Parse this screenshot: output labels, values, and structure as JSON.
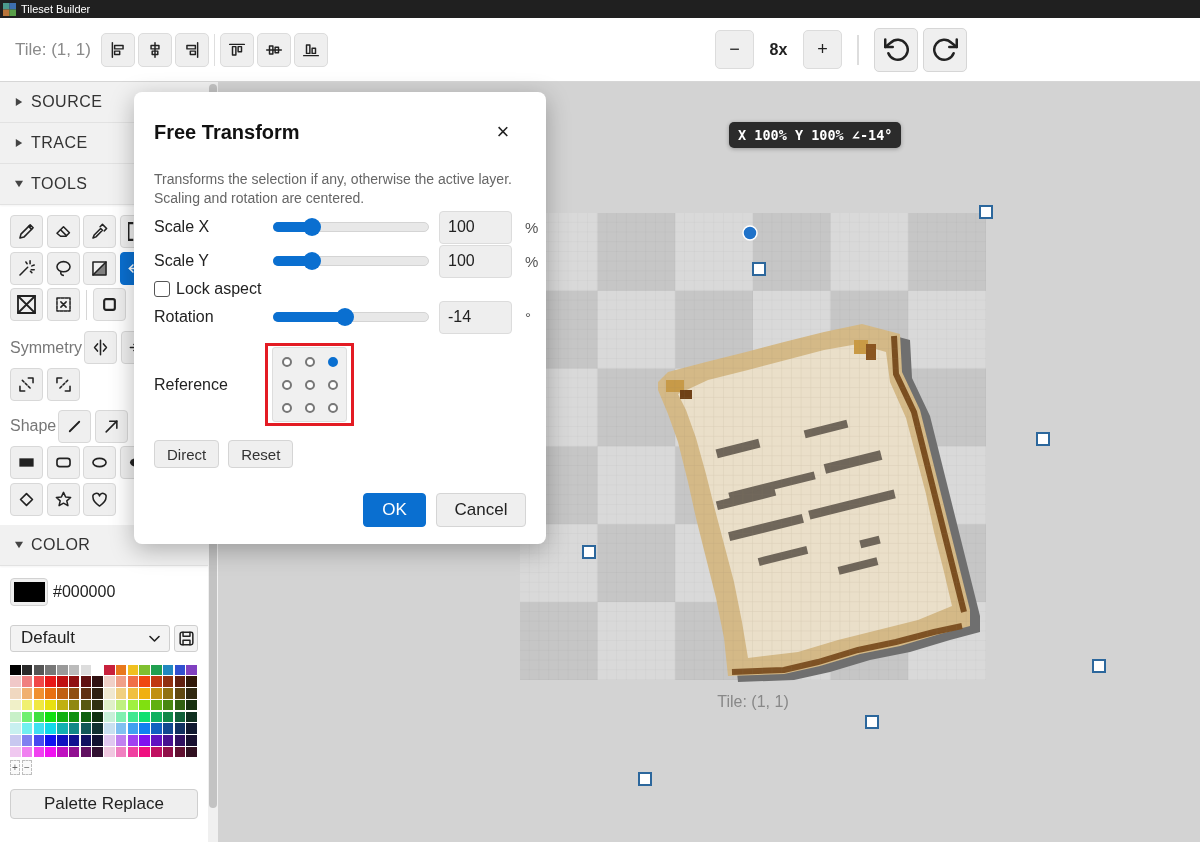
{
  "window": {
    "title": "Tileset Builder"
  },
  "toolbar": {
    "tile": "Tile: (1, 1)",
    "zoom_out": "−",
    "zoom_level": "8x",
    "zoom_in": "+"
  },
  "sidebar": {
    "sections": [
      {
        "kind": "plain",
        "title": "SOURCE",
        "expanded": false
      },
      {
        "kind": "plain",
        "title": "TRACE",
        "expanded": false
      },
      {
        "kind": "tools",
        "title": "TOOLS",
        "expanded": true,
        "tool_rows": [
          [
            [
              {
                "selected": false
              },
              {
                "selected": false
              },
              {
                "selected": false
              },
              {
                "selected": false
              }
            ]
          ],
          [
            [
              {
                "selected": false
              },
              {
                "selected": false
              },
              {
                "selected": false
              },
              {
                "selected": true
              }
            ]
          ],
          [
            [
              {
                "selected": false
              },
              {
                "selected": false
              }
            ],
            [
              {
                "selected": false
              }
            ]
          ]
        ],
        "symmetry_label": "Symmetry",
        "shape_label": "Shape"
      },
      {
        "kind": "color",
        "title": "COLOR",
        "expanded": true,
        "current": {
          "color": "#000000",
          "hex": "#000000"
        },
        "palette_name": "Default",
        "palette_rows": [
          {
            "left": [
              {
                "color": "#000000"
              },
              {
                "color": "#2a2a2a"
              },
              {
                "color": "#555555"
              },
              {
                "color": "#777777"
              },
              {
                "color": "#999999"
              },
              {
                "color": "#bbbbbb"
              },
              {
                "color": "#dddddd"
              }
            ],
            "right": [
              {
                "color": "#c8203c"
              },
              {
                "color": "#e8781c"
              },
              {
                "color": "#f0c020"
              },
              {
                "color": "#80c030"
              },
              {
                "color": "#20a050"
              },
              {
                "color": "#2088c0"
              },
              {
                "color": "#3050d0"
              },
              {
                "color": "#8040c0"
              }
            ]
          },
          {
            "left": [
              {
                "color": "#f0c8c8"
              },
              {
                "color": "#f08080"
              },
              {
                "color": "#f04848"
              },
              {
                "color": "#e81818"
              },
              {
                "color": "#c01010"
              },
              {
                "color": "#901010"
              },
              {
                "color": "#601010"
              },
              {
                "color": "#301010"
              }
            ],
            "right": [
              {
                "color": "#f0d0c8"
              },
              {
                "color": "#f0a088"
              },
              {
                "color": "#f07048"
              },
              {
                "color": "#f04810"
              },
              {
                "color": "#c03810"
              },
              {
                "color": "#903010"
              },
              {
                "color": "#602010"
              },
              {
                "color": "#301808"
              }
            ]
          },
          {
            "left": [
              {
                "color": "#f0d8c0"
              },
              {
                "color": "#f0b070"
              },
              {
                "color": "#f09030"
              },
              {
                "color": "#e87010"
              },
              {
                "color": "#c06010"
              },
              {
                "color": "#905010"
              },
              {
                "color": "#603010"
              },
              {
                "color": "#302010"
              }
            ],
            "right": [
              {
                "color": "#f0e8d0"
              },
              {
                "color": "#f0d080"
              },
              {
                "color": "#f0c040"
              },
              {
                "color": "#f0b010"
              },
              {
                "color": "#c09010"
              },
              {
                "color": "#907010"
              },
              {
                "color": "#604810"
              },
              {
                "color": "#302810"
              }
            ]
          },
          {
            "left": [
              {
                "color": "#f0f0c8"
              },
              {
                "color": "#f0f070"
              },
              {
                "color": "#f0e840"
              },
              {
                "color": "#e8e010"
              },
              {
                "color": "#c0b010"
              },
              {
                "color": "#908810"
              },
              {
                "color": "#585810"
              },
              {
                "color": "#303010"
              }
            ],
            "right": [
              {
                "color": "#e0f0c8"
              },
              {
                "color": "#c0f080"
              },
              {
                "color": "#a0f040"
              },
              {
                "color": "#80e010"
              },
              {
                "color": "#60b010"
              },
              {
                "color": "#488810"
              },
              {
                "color": "#306010"
              },
              {
                "color": "#183010"
              }
            ]
          },
          {
            "left": [
              {
                "color": "#c8f0c8"
              },
              {
                "color": "#70f070"
              },
              {
                "color": "#40e040"
              },
              {
                "color": "#10e010"
              },
              {
                "color": "#10b010"
              },
              {
                "color": "#109010"
              },
              {
                "color": "#106010"
              },
              {
                "color": "#103010"
              }
            ],
            "right": [
              {
                "color": "#c8f0d8"
              },
              {
                "color": "#80f0b0"
              },
              {
                "color": "#40e890"
              },
              {
                "color": "#10e070"
              },
              {
                "color": "#10b060"
              },
              {
                "color": "#108848"
              },
              {
                "color": "#106038"
              },
              {
                "color": "#103020"
              }
            ]
          },
          {
            "left": [
              {
                "color": "#c8f0f0"
              },
              {
                "color": "#70f0f0"
              },
              {
                "color": "#40e0f0"
              },
              {
                "color": "#10d8e8"
              },
              {
                "color": "#10b0b0"
              },
              {
                "color": "#108888"
              },
              {
                "color": "#105858"
              },
              {
                "color": "#103030"
              }
            ],
            "right": [
              {
                "color": "#c8e0f0"
              },
              {
                "color": "#80c0f0"
              },
              {
                "color": "#40a0f0"
              },
              {
                "color": "#1080f0"
              },
              {
                "color": "#1060c0"
              },
              {
                "color": "#104890"
              },
              {
                "color": "#103060"
              },
              {
                "color": "#101830"
              }
            ]
          },
          {
            "left": [
              {
                "color": "#c8c8f0"
              },
              {
                "color": "#8080f0"
              },
              {
                "color": "#4848f0"
              },
              {
                "color": "#1010f0"
              },
              {
                "color": "#1010c0"
              },
              {
                "color": "#101090"
              },
              {
                "color": "#101060"
              },
              {
                "color": "#101030"
              }
            ],
            "right": [
              {
                "color": "#e0c8f0"
              },
              {
                "color": "#c080f0"
              },
              {
                "color": "#a040f0"
              },
              {
                "color": "#8010f0"
              },
              {
                "color": "#6010c0"
              },
              {
                "color": "#481090"
              },
              {
                "color": "#301060"
              },
              {
                "color": "#181030"
              }
            ]
          },
          {
            "left": [
              {
                "color": "#f0c8f0"
              },
              {
                "color": "#f080f0"
              },
              {
                "color": "#f040f0"
              },
              {
                "color": "#f010f0"
              },
              {
                "color": "#c010c0"
              },
              {
                "color": "#901090"
              },
              {
                "color": "#601060"
              },
              {
                "color": "#301030"
              }
            ],
            "right": [
              {
                "color": "#f0c8e0"
              },
              {
                "color": "#f080c0"
              },
              {
                "color": "#f040a0"
              },
              {
                "color": "#f01080"
              },
              {
                "color": "#c01060"
              },
              {
                "color": "#901048"
              },
              {
                "color": "#601030"
              },
              {
                "color": "#301020"
              }
            ]
          }
        ],
        "add": "+",
        "remove": "−",
        "replace": "Palette Replace"
      }
    ]
  },
  "canvas": {
    "readout": "X 100% Y 100% ∠-14°",
    "caption": "Tile: (1, 1)"
  },
  "dialog": {
    "title": "Free Transform",
    "close": "×",
    "description": [
      "Transforms the selection if any, otherwise the active layer.",
      "Scaling and rotation are centered."
    ],
    "rows": [
      {
        "kind": "slider",
        "label": "Scale X",
        "level": 0.25,
        "value": "100",
        "unit": "%"
      },
      {
        "kind": "slider",
        "label": "Scale Y",
        "level": 0.25,
        "value": "100",
        "unit": "%"
      },
      {
        "kind": "checkbox",
        "label": "Lock aspect",
        "checked": false
      },
      {
        "kind": "slider",
        "label": "Rotation",
        "level": 0.46,
        "value": "-14",
        "unit": "°"
      }
    ],
    "reference": {
      "label": "Reference",
      "highlighted": true,
      "points": [
        {
          "selected": false
        },
        {
          "selected": false
        },
        {
          "selected": true
        },
        {
          "selected": false
        },
        {
          "selected": false
        },
        {
          "selected": false
        },
        {
          "selected": false
        },
        {
          "selected": false
        },
        {
          "selected": false
        }
      ]
    },
    "buttons": [
      "Direct",
      "Reset"
    ],
    "actions": [
      {
        "label": "OK",
        "primary": true
      },
      {
        "label": "Cancel",
        "primary": false
      }
    ]
  }
}
